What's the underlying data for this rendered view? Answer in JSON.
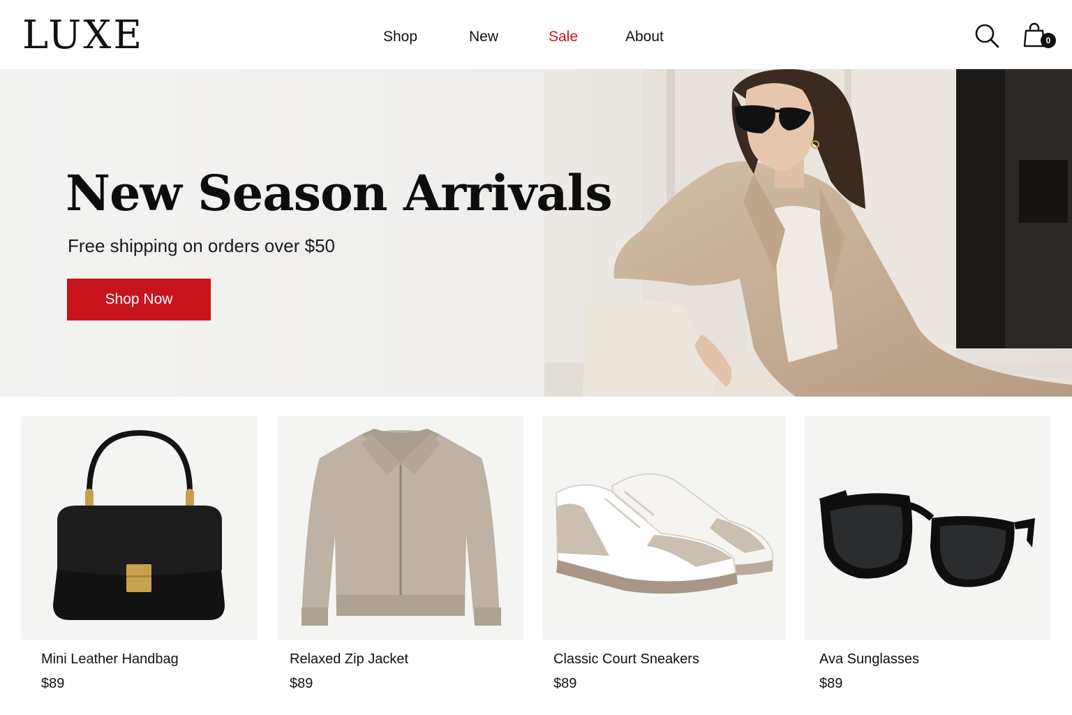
{
  "brand": {
    "logo": "LUXE"
  },
  "nav": {
    "items": [
      {
        "label": "Shop"
      },
      {
        "label": "New"
      },
      {
        "label": "Sale",
        "highlight": true
      },
      {
        "label": "About"
      }
    ]
  },
  "header_actions": {
    "search_icon": "search-icon",
    "cart_icon": "shopping-bag-icon",
    "cart_count": "0"
  },
  "hero": {
    "title": "New Season Arrivals",
    "subtitle": "Free shipping on orders over $50",
    "cta": "Shop Now"
  },
  "products": [
    {
      "name": "Mini Leather Handbag",
      "price": "$89"
    },
    {
      "name": "Relaxed Zip Jacket",
      "price": "$89"
    },
    {
      "name": "Classic Court Sneakers",
      "price": "$89"
    },
    {
      "name": "Ava Sunglasses",
      "price": "$89"
    }
  ],
  "colors": {
    "accent": "#c8131b",
    "text": "#111111",
    "card_bg": "#f4f4f3",
    "coat": "#c9b49c"
  }
}
